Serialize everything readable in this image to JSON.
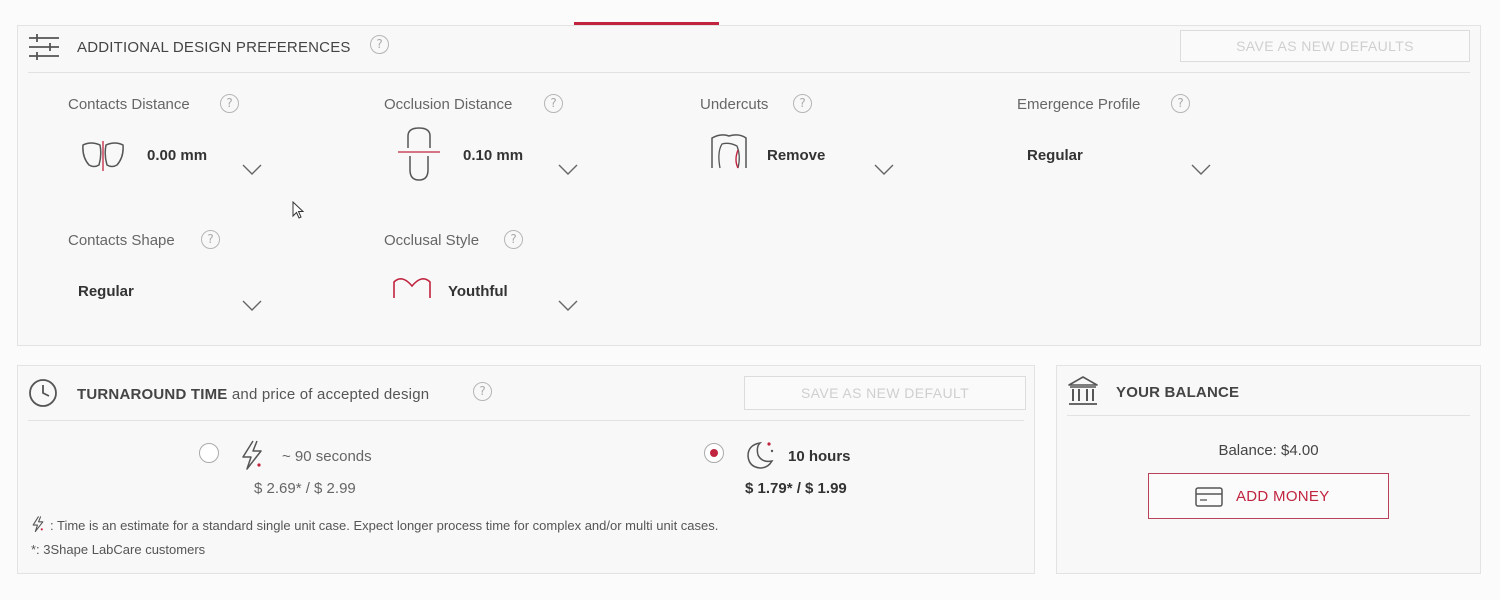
{
  "colors": {
    "accent": "#c0243f",
    "border": "#e3e3e3",
    "text": "#444444"
  },
  "design": {
    "title": "ADDITIONAL DESIGN PREFERENCES",
    "title_icon": "sliders-icon",
    "help_icon": "help-icon",
    "save_button": "SAVE AS NEW DEFAULTS",
    "prefs": {
      "contacts_distance": {
        "label": "Contacts Distance",
        "value": "0.00 mm",
        "icon": "contacts-distance-icon"
      },
      "occlusion_distance": {
        "label": "Occlusion Distance",
        "value": "0.10 mm",
        "icon": "occlusion-distance-icon"
      },
      "undercuts": {
        "label": "Undercuts",
        "value": "Remove",
        "icon": "undercuts-icon"
      },
      "emergence_profile": {
        "label": "Emergence Profile",
        "value": "Regular"
      },
      "contacts_shape": {
        "label": "Contacts Shape",
        "value": "Regular"
      },
      "occlusal_style": {
        "label": "Occlusal Style",
        "value": "Youthful",
        "icon": "youthful-style-icon"
      }
    }
  },
  "turnaround": {
    "title_bold": "TURNAROUND TIME",
    "title_rest": "and price of accepted design",
    "title_icon": "clock-icon",
    "save_button": "SAVE AS NEW DEFAULT",
    "options": {
      "fast": {
        "time": "~ 90 seconds",
        "price": "$ 2.69* / $ 2.99",
        "selected": false,
        "icon": "lightning-icon"
      },
      "slow": {
        "time": "10 hours",
        "price": "$ 1.79* / $ 1.99",
        "selected": true,
        "icon": "moon-icon"
      }
    },
    "footnote_time": ": Time is an estimate for a standard single unit case. Expect longer process time for complex and/or multi unit cases.",
    "footnote_star": "*: 3Shape LabCare customers"
  },
  "balance": {
    "title": "YOUR BALANCE",
    "title_icon": "bank-icon",
    "balance_text": "Balance: $4.00",
    "add_money_label": "ADD MONEY",
    "add_money_icon": "credit-card-icon"
  }
}
